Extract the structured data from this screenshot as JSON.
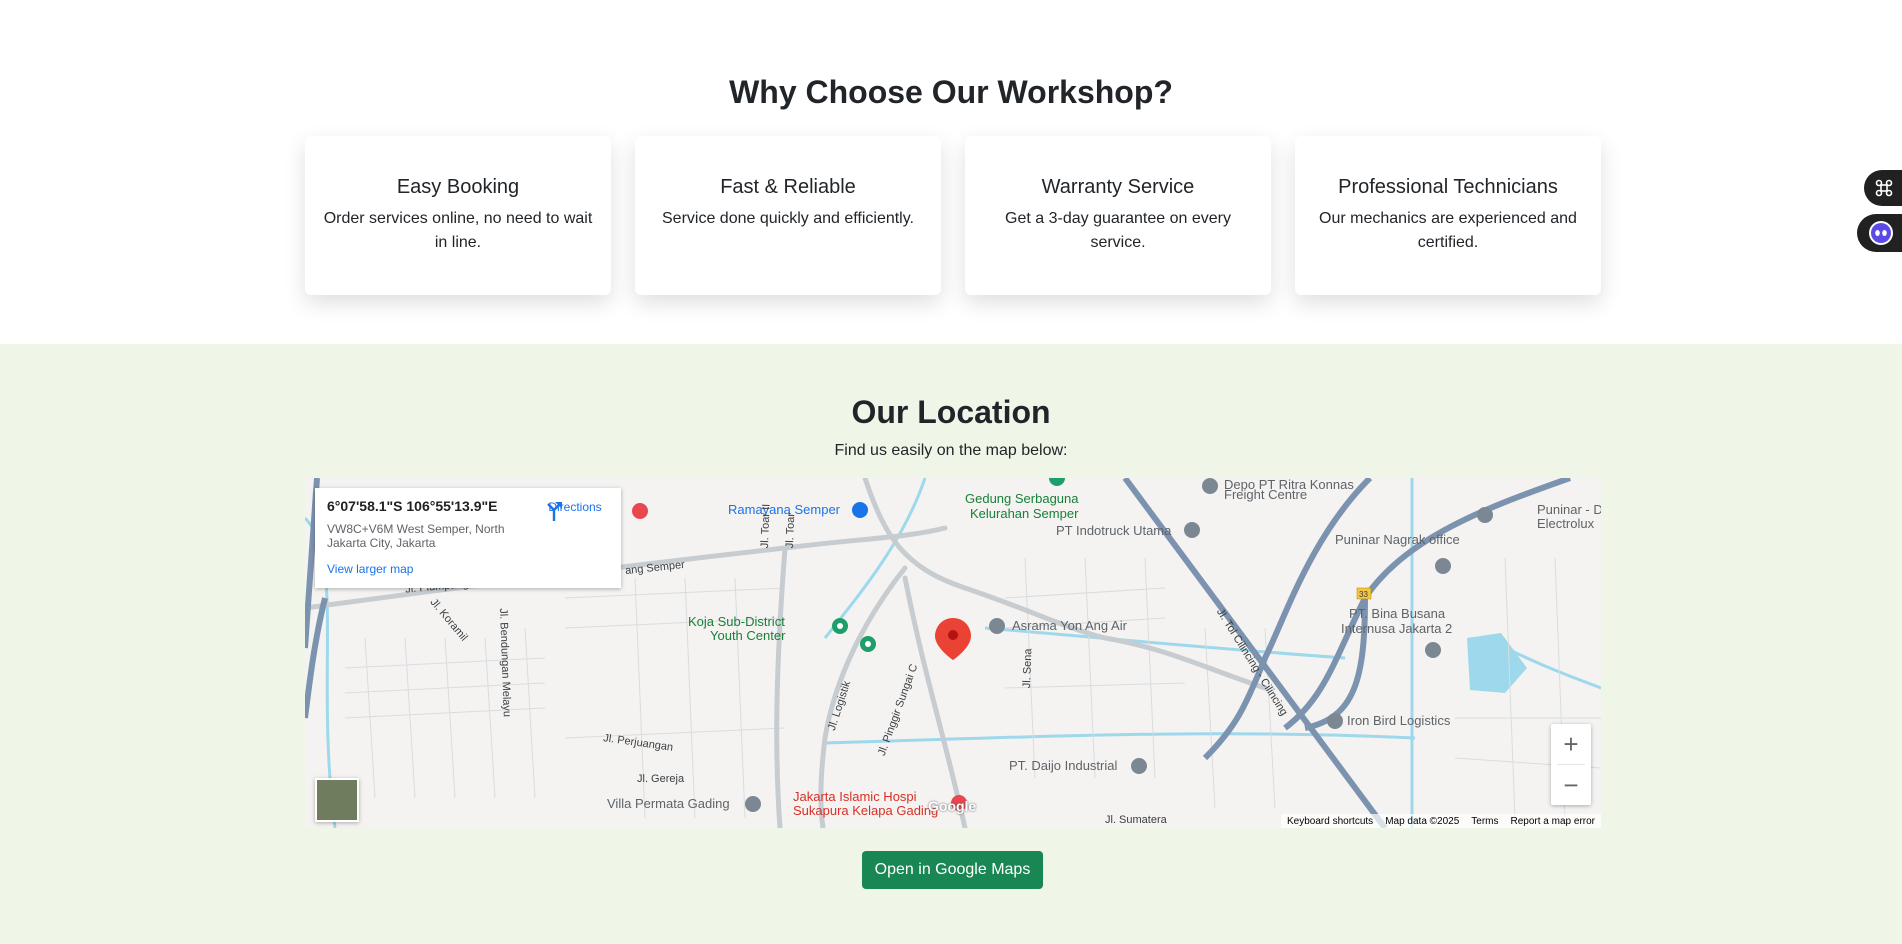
{
  "why": {
    "title": "Why Choose Our Workshop?",
    "cards": [
      {
        "title": "Easy Booking",
        "text": "Order services online, no need to wait in line."
      },
      {
        "title": "Fast & Reliable",
        "text": "Service done quickly and efficiently."
      },
      {
        "title": "Warranty Service",
        "text": "Get a 3-day guarantee on every service."
      },
      {
        "title": "Professional Technicians",
        "text": "Our mechanics are experienced and certified."
      }
    ]
  },
  "location": {
    "title": "Our Location",
    "subtitle": "Find us easily on the map below:",
    "open_button": "Open in Google Maps"
  },
  "map": {
    "info": {
      "coords": "6°07'58.1\"S 106°55'13.9\"E",
      "address": "VW8C+V6M West Semper, North Jakarta City, Jakarta",
      "directions": "Directions",
      "larger_map": "View larger map"
    },
    "places": {
      "ramayana": "Ramayana Semper",
      "gedung": "Gedung Serbaguna",
      "kelurahan": "Kelurahan Semper",
      "indotruck": "PT Indotruck Utama",
      "depo": "Depo PT Ritra Konnas",
      "freight": "Freight Centre",
      "puninar_nagrak": "Puninar Nagrak office",
      "puninar_d": "Puninar - D",
      "electrolux": "Electrolux",
      "bina": "PT. Bina Busana",
      "internusa": "Internusa Jakarta 2",
      "koja": "Koja Sub-District",
      "youth": "Youth Center",
      "asrama": "Asrama Yon Ang Air",
      "iron_bird": "Iron Bird Logistics",
      "daijo": "PT. Daijo Industrial",
      "villa": "Villa Permata Gading",
      "hospital1": "Jakarta Islamic Hospi",
      "hospital2": "Sukapura Kelapa Gading"
    },
    "roads": {
      "plumpang": "Jl. Plumpang Semper",
      "ang_semper": "ang Semper",
      "koramil": "Jl. Koramil",
      "bendungan": "Jl. Bendungan Melayu",
      "toar1": "Jl. Toar II",
      "toar": "Jl. Toar",
      "logistik": "Jl. Logistik",
      "pinggir": "Jl. Pinggir Sungai C",
      "sena": "Jl. Sena",
      "perjuangan": "Jl. Perjuangan",
      "gereja": "Jl. Gereja",
      "cilincing": "Jl. Tol Cilincing - Cilincing",
      "sumatera": "Jl. Sumatera",
      "route33": "33"
    },
    "attribution": {
      "shortcuts": "Keyboard shortcuts",
      "data": "Map data ©2025",
      "terms": "Terms",
      "report": "Report a map error"
    },
    "google": "Google",
    "zoom_in": "+",
    "zoom_out": "−"
  },
  "icons": {
    "side_top": "command-icon",
    "side_bottom": "bot-face-icon"
  }
}
